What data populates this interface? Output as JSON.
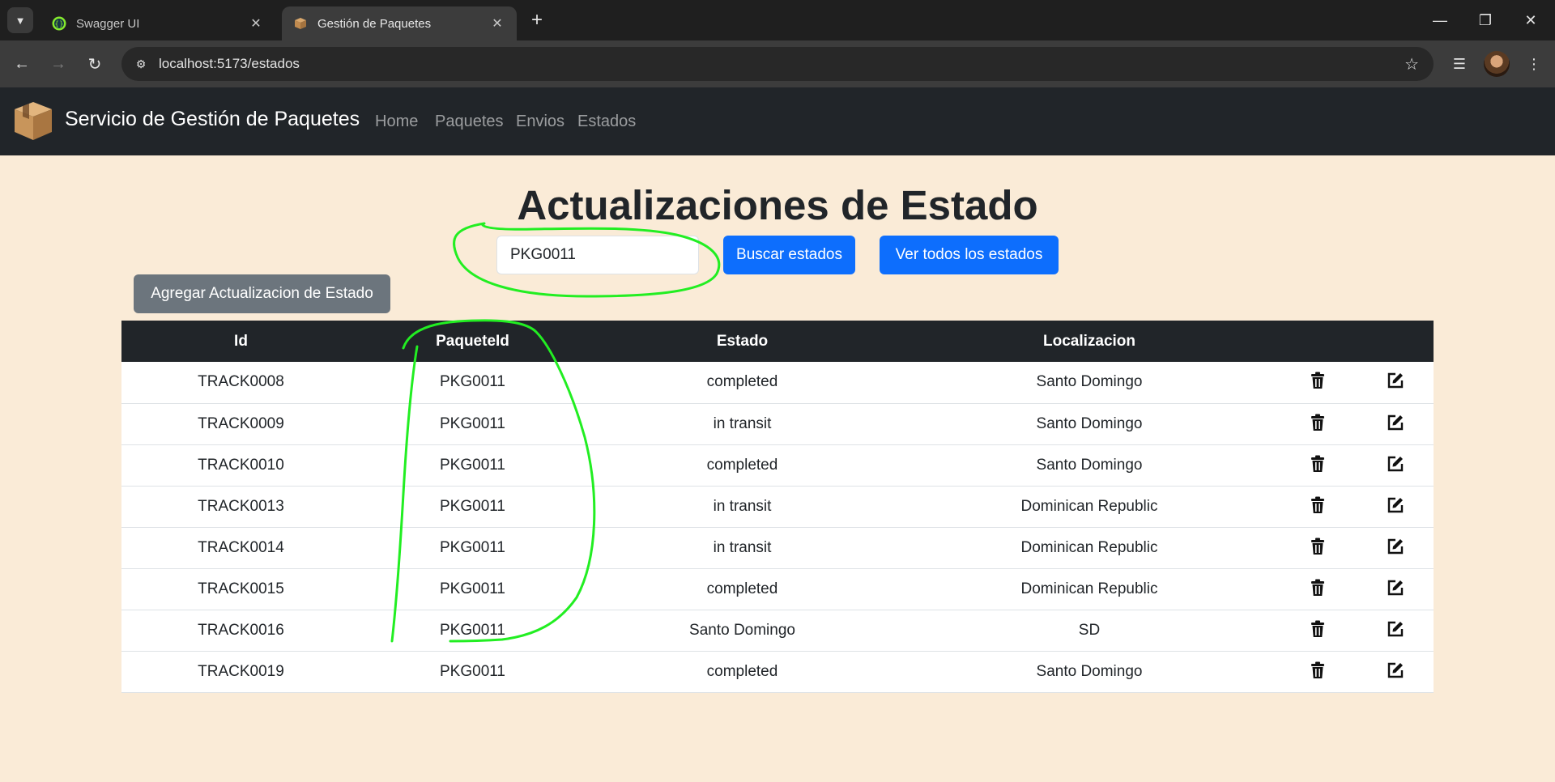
{
  "browser": {
    "tabs": [
      {
        "title": "Swagger UI",
        "active": false
      },
      {
        "title": "Gestión de Paquetes",
        "active": true
      }
    ],
    "url": "localhost:5173/estados"
  },
  "navbar": {
    "brand": "Servicio de Gestión de Paquetes",
    "links": [
      "Home",
      "Paquetes",
      "Envios",
      "Estados"
    ]
  },
  "page": {
    "title": "Actualizaciones de Estado",
    "search_value": "PKG0011",
    "search_button": "Buscar estados",
    "view_all_button": "Ver todos los estados",
    "add_button": "Agregar Actualizacion de Estado"
  },
  "table": {
    "headers": [
      "Id",
      "PaqueteId",
      "Estado",
      "Localizacion",
      "",
      ""
    ],
    "rows": [
      {
        "id": "TRACK0008",
        "paquete": "PKG0011",
        "estado": "completed",
        "localizacion": "Santo Domingo"
      },
      {
        "id": "TRACK0009",
        "paquete": "PKG0011",
        "estado": "in transit",
        "localizacion": "Santo Domingo"
      },
      {
        "id": "TRACK0010",
        "paquete": "PKG0011",
        "estado": "completed",
        "localizacion": "Santo Domingo"
      },
      {
        "id": "TRACK0013",
        "paquete": "PKG0011",
        "estado": "in transit",
        "localizacion": "Dominican Republic"
      },
      {
        "id": "TRACK0014",
        "paquete": "PKG0011",
        "estado": "in transit",
        "localizacion": "Dominican Republic"
      },
      {
        "id": "TRACK0015",
        "paquete": "PKG0011",
        "estado": "completed",
        "localizacion": "Dominican Republic"
      },
      {
        "id": "TRACK0016",
        "paquete": "PKG0011",
        "estado": "Santo Domingo",
        "localizacion": "SD"
      },
      {
        "id": "TRACK0019",
        "paquete": "PKG0011",
        "estado": "completed",
        "localizacion": "Santo Domingo"
      }
    ]
  },
  "icons": {
    "delete": "trash-icon",
    "edit": "edit-icon"
  },
  "colors": {
    "background": "#faebd7",
    "navbar": "#212529",
    "primary": "#0d6efd",
    "secondary": "#6c757d",
    "annotation": "#22ee22"
  }
}
